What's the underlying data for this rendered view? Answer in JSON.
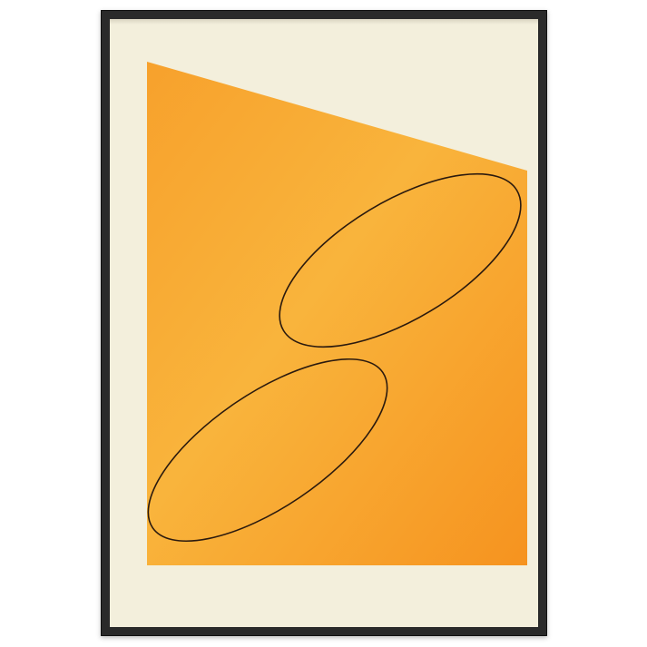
{
  "artwork": {
    "signature_left": "",
    "signature_right": ""
  },
  "colors": {
    "frame": "#2a2a2a",
    "mat": "#f3efdc",
    "orange_light": "#f9b23a",
    "orange_dark": "#f6931f",
    "line": "#2b1a0e"
  }
}
